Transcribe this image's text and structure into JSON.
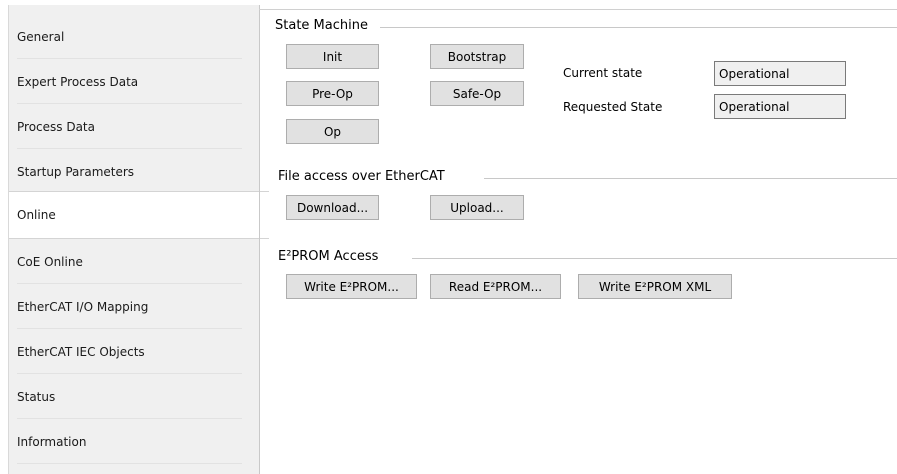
{
  "sidebar": {
    "items": [
      {
        "label": "General"
      },
      {
        "label": "Expert Process Data"
      },
      {
        "label": "Process Data"
      },
      {
        "label": "Startup Parameters"
      },
      {
        "label": "Online",
        "active": true
      },
      {
        "label": "CoE Online"
      },
      {
        "label": "EtherCAT I/O Mapping"
      },
      {
        "label": "EtherCAT IEC Objects"
      },
      {
        "label": "Status"
      },
      {
        "label": "Information"
      }
    ]
  },
  "state_machine": {
    "title": "State Machine",
    "buttons": {
      "init": "Init",
      "bootstrap": "Bootstrap",
      "preop": "Pre-Op",
      "safeop": "Safe-Op",
      "op": "Op"
    },
    "current_state_label": "Current state",
    "current_state_value": "Operational",
    "requested_state_label": "Requested State",
    "requested_state_value": "Operational"
  },
  "file_access": {
    "title": "File access over EtherCAT",
    "download": "Download...",
    "upload": "Upload..."
  },
  "eeprom": {
    "title": "E²PROM Access",
    "write": "Write E²PROM...",
    "read": "Read E²PROM...",
    "write_xml": "Write E²PROM XML"
  }
}
